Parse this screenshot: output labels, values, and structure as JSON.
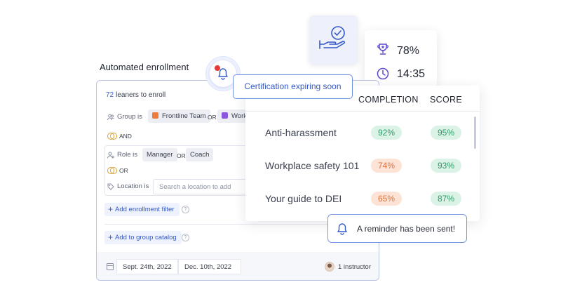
{
  "enrollment": {
    "title": "Automated enrollment",
    "count": "72",
    "count_label": "leaners to enroll",
    "group_label": "Group is",
    "group_chips": [
      {
        "label": "Frontline Team",
        "color": "#f07a3a"
      },
      {
        "label": "Work",
        "color": "#8b55e0"
      }
    ],
    "or_text": "OR",
    "and_text": "AND",
    "role_label": "Role is",
    "role_chips": [
      "Manager",
      "Coach"
    ],
    "or_logic": "OR",
    "location_label": "Location is",
    "location_placeholder": "Search a location to add",
    "add_filter": "Add enrollment filter",
    "add_catalog": "Add to group catalog",
    "help": "?",
    "start_date": "Sept. 24th, 2022",
    "end_date": "Dec. 10th, 2022",
    "instructors": "1 instructor"
  },
  "notification": {
    "certification": "Certification expiring soon",
    "reminder": "A reminder has been sent!"
  },
  "stats": {
    "completion": "78%",
    "time": "14:35"
  },
  "courses": {
    "headers": {
      "completion": "COMPLETION",
      "score": "SCORE"
    },
    "rows": [
      {
        "name": "Anti-harassment",
        "completion": "92%",
        "completion_status": "green",
        "score": "95%",
        "score_status": "green"
      },
      {
        "name": "Workplace safety 101",
        "completion": "74%",
        "completion_status": "orange",
        "score": "93%",
        "score_status": "green"
      },
      {
        "name": "Your guide to DEI",
        "completion": "65%",
        "completion_status": "orange",
        "score": "87%",
        "score_status": "green"
      }
    ]
  },
  "colors": {
    "accent": "#3659c7",
    "green_text": "#2f9a66",
    "orange_text": "#e0743f",
    "alert_dot": "#e5383b"
  },
  "icons": {
    "bell": "bell-icon",
    "trophy": "trophy-icon",
    "clock": "clock-icon",
    "hand_check": "hand-check-icon",
    "calendar": "calendar-icon"
  }
}
